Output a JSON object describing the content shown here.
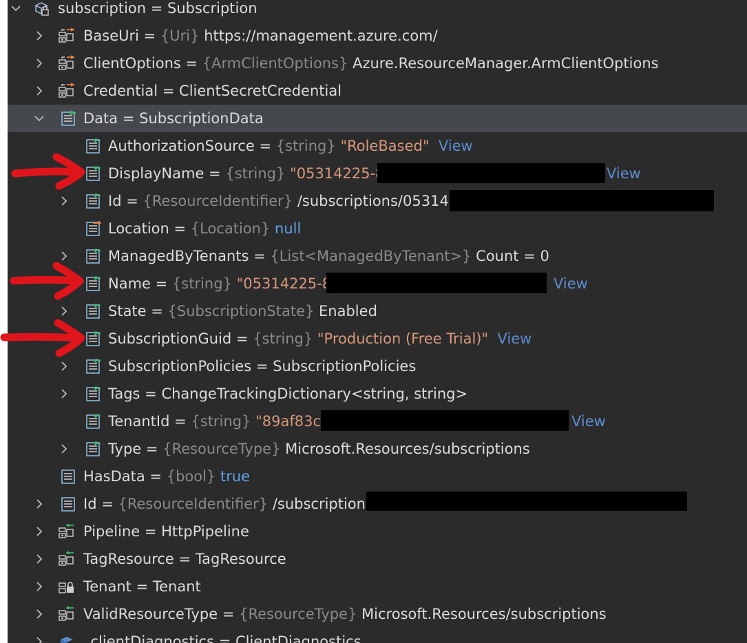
{
  "rows": [
    {
      "name": "subscription",
      "type": "",
      "value": "Subscription",
      "view": ""
    },
    {
      "name": "BaseUri",
      "type": "{Uri}",
      "value": "https://management.azure.com/",
      "view": ""
    },
    {
      "name": "ClientOptions",
      "type": "{ArmClientOptions}",
      "value": "Azure.ResourceManager.ArmClientOptions",
      "view": ""
    },
    {
      "name": "Credential",
      "type": "",
      "value": "ClientSecretCredential",
      "view": ""
    },
    {
      "name": "Data",
      "type": "",
      "value": "SubscriptionData",
      "view": ""
    },
    {
      "name": "AuthorizationSource",
      "type": "{string}",
      "value": "\"RoleBased\"",
      "view": "View"
    },
    {
      "name": "DisplayName",
      "type": "{string}",
      "value": "\"05314225-85",
      "view": "View"
    },
    {
      "name": "Id",
      "type": "{ResourceIdentifier}",
      "value": "/subscriptions/053142",
      "view": ""
    },
    {
      "name": "Location",
      "type": "{Location}",
      "value": "null",
      "view": ""
    },
    {
      "name": "ManagedByTenants",
      "type": "{List<ManagedByTenant>}",
      "value": "Count = 0",
      "view": ""
    },
    {
      "name": "Name",
      "type": "{string}",
      "value": "\"05314225-85",
      "view": "View"
    },
    {
      "name": "State",
      "type": "{SubscriptionState}",
      "value": "Enabled",
      "view": ""
    },
    {
      "name": "SubscriptionGuid",
      "type": "{string}",
      "value": "\"Production (Free Trial)\"",
      "view": "View"
    },
    {
      "name": "SubscriptionPolicies",
      "type": "",
      "value": "SubscriptionPolicies",
      "view": ""
    },
    {
      "name": "Tags",
      "type": "",
      "value": "ChangeTrackingDictionary<string, string>",
      "view": ""
    },
    {
      "name": "TenantId",
      "type": "{string}",
      "value": "\"89af83cc",
      "view": "View"
    },
    {
      "name": "Type",
      "type": "{ResourceType}",
      "value": "Microsoft.Resources/subscriptions",
      "view": ""
    },
    {
      "name": "HasData",
      "type": "{bool}",
      "value": "true",
      "view": ""
    },
    {
      "name": "Id",
      "type": "{ResourceIdentifier}",
      "value": "/subscriptions",
      "view": ""
    },
    {
      "name": "Pipeline",
      "type": "",
      "value": "HttpPipeline",
      "view": ""
    },
    {
      "name": "TagResource",
      "type": "",
      "value": "TagResource",
      "view": ""
    },
    {
      "name": "Tenant",
      "type": "",
      "value": "Tenant",
      "view": ""
    },
    {
      "name": "ValidResourceType",
      "type": "{ResourceType}",
      "value": "Microsoft.Resources/subscriptions",
      "view": ""
    },
    {
      "name": "_clientDiagnostics",
      "type": "",
      "value": "ClientDiagnostics",
      "view": ""
    }
  ],
  "colors": {
    "background": "#2b2b2b",
    "selected_row": "#45484d",
    "string_value": "#d8987a",
    "keyword_value": "#5ea3e6",
    "view_link": "#5d8dd1",
    "type_hint": "#8a8a8a",
    "annotation_arrow": "#e0141b"
  }
}
